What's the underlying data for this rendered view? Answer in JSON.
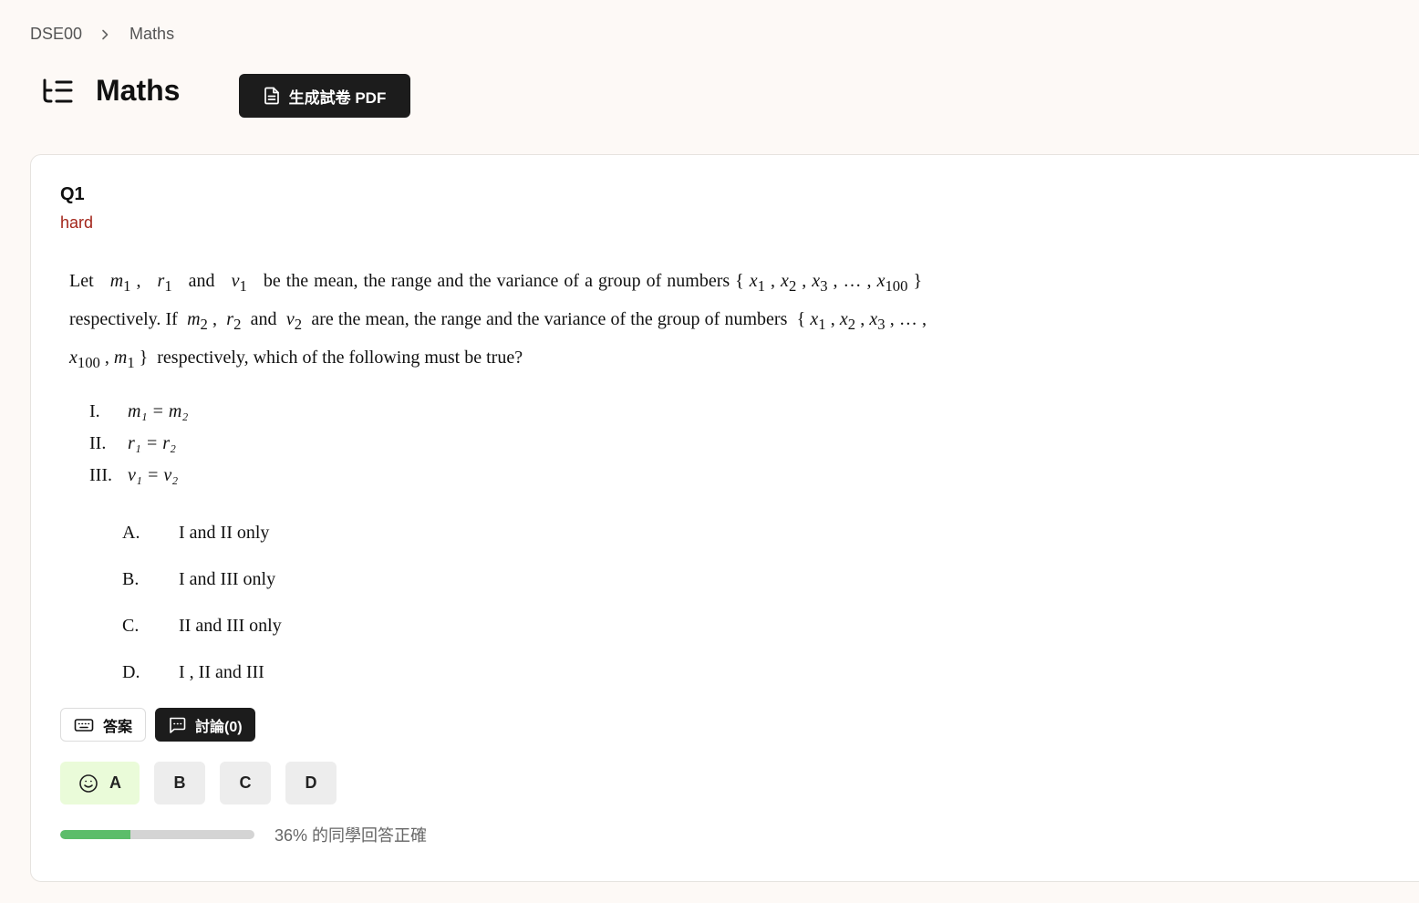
{
  "breadcrumb": {
    "root": "DSE00",
    "current": "Maths"
  },
  "header": {
    "title": "Maths",
    "pdf_button": "生成試卷 PDF"
  },
  "question": {
    "number": "Q1",
    "difficulty": "hard",
    "stem_1": "Let",
    "stem_2": "be the mean, the range and the variance of a group of numbers",
    "stem_3": "respectively. If",
    "stem_4": "are the mean, the range and the variance of the",
    "stem_5": "group of numbers",
    "stem_6": "respectively, which of the following must be true?",
    "statements": [
      {
        "num": "I.",
        "text": "m₁ = m₂"
      },
      {
        "num": "II.",
        "text": "r₁ = r₂"
      },
      {
        "num": "III.",
        "text": "v₁ = v₂"
      }
    ],
    "options": [
      {
        "label": "A.",
        "text": "I and II only"
      },
      {
        "label": "B.",
        "text": "I and III only"
      },
      {
        "label": "C.",
        "text": "II and III only"
      },
      {
        "label": "D.",
        "text": "I , II and III"
      }
    ]
  },
  "actions": {
    "answer": "答案",
    "discussion": "討論(0)"
  },
  "choices": [
    "A",
    "B",
    "C",
    "D"
  ],
  "stats": {
    "percent_correct": 36,
    "text": "36% 的同學回答正確"
  },
  "colors": {
    "accent_dark": "#1c1c1c",
    "difficulty_hard": "#a3261b",
    "correct_bg": "#eafbd9",
    "progress": "#5cbd6a"
  }
}
